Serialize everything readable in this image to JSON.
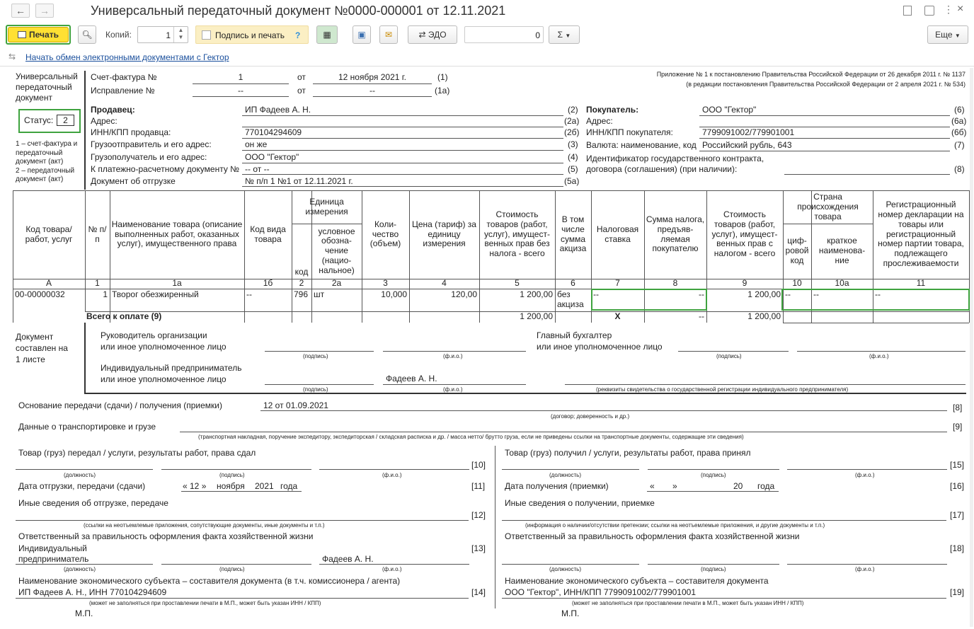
{
  "window": {
    "title": "Универсальный передаточный документ №0000-000001 от 12.11.2021",
    "back_icon": "arrow-left-icon",
    "forward_icon": "arrow-right-icon"
  },
  "toolbar": {
    "print_label": "Печать",
    "copies_label": "Копий:",
    "copies_value": "1",
    "sign_print_label": "Подпись и печать",
    "help_mark": "?",
    "edo_label": "ЭДО",
    "sum_value": "0",
    "sigma_label": "Σ",
    "more_label": "Еще"
  },
  "link_exchange": "Начать обмен электронными документами с Гектор",
  "left_panel": {
    "doc_type": [
      "Универсальный",
      "передаточный",
      "документ"
    ],
    "status_label": "Статус:",
    "status_value": "2",
    "status_note1": [
      "1 – счет-фактура и",
      "передаточный",
      "документ (акт)"
    ],
    "status_note2": [
      "2 – передаточный",
      "документ (акт)"
    ],
    "compiled_on": [
      "Документ",
      "составлен на",
      "1 листе"
    ]
  },
  "invoice": {
    "sf_label": "Счет-фактура №",
    "sf_no": "1",
    "from_label": "от",
    "sf_date": "12 ноября 2021 г.",
    "sf_ref": "(1)",
    "corr_label": "Исправление №",
    "corr_no": "--",
    "corr_date": "--",
    "corr_ref": "(1а)",
    "appendix1": "Приложение № 1 к постановлению Правительства Российской Федерации от 26 декабря 2011 г. № 1137",
    "appendix2": "(в редакции постановления Правительства Российской Федерации от 2 апреля 2021 г. № 534)"
  },
  "seller": {
    "label": "Продавец:",
    "value": "ИП Фадеев А. Н.",
    "ref": "(2)",
    "addr_label": "Адрес:",
    "addr_ref": "(2а)",
    "inn_label": "ИНН/КПП продавца:",
    "inn_value": "770104294609",
    "inn_ref": "(2б)",
    "shipper_label": "Грузоотправитель и его адрес:",
    "shipper_value": "он же",
    "shipper_ref": "(3)",
    "consignee_label": "Грузополучатель и его адрес:",
    "consignee_value": "ООО \"Гектор\"",
    "consignee_ref": "(4)",
    "paydoc_label": "К платежно-расчетному документу №",
    "paydoc_value": "-- от --",
    "paydoc_ref": "(5)",
    "shipdoc_label": "Документ об отгрузке",
    "shipdoc_value": "№ п/п 1 №1 от 12.11.2021 г.",
    "shipdoc_ref": "(5а)"
  },
  "buyer": {
    "label": "Покупатель:",
    "value": "ООО \"Гектор\"",
    "ref": "(6)",
    "addr_label": "Адрес:",
    "addr_ref": "(6а)",
    "inn_label": "ИНН/КПП покупателя:",
    "inn_value": "7799091002/779901001",
    "inn_ref": "(6б)",
    "currency_label": "Валюта: наименование, код",
    "currency_value": "Российский рубль, 643",
    "currency_ref": "(7)",
    "contract_label1": "Идентификатор государственного контракта,",
    "contract_label2": "договора (соглашения) (при наличии):",
    "contract_ref": "(8)"
  },
  "table": {
    "headers": {
      "code": "Код товара/ работ, услуг",
      "n": "№ п/п",
      "name": "Наименование товара (описание выполненных работ, оказанных услуг), имущественного права",
      "kind": "Код вида товара",
      "unit": "Единица измерения",
      "unit_code": "код",
      "unit_name": "условное обозна-чение (нацио-нальное)",
      "qty": "Коли-чество (объем)",
      "price": "Цена (тариф) за единицу измерения",
      "cost": "Стоимость товаров (работ, услуг), имущест-венных прав без налога - всего",
      "excise": "В том числе сумма акциза",
      "rate": "Налоговая ставка",
      "tax": "Сумма налога, предъяв-ляемая покупателю",
      "total": "Стоимость товаров (работ, услуг), имущест-венных прав с налогом - всего",
      "country": "Страна происхождения товара",
      "country_code": "циф-ровой код",
      "country_name": "краткое наименова-ние",
      "reg": "Регистрационный номер декларации на товары или регистрационный номер партии товара, подлежащего прослеживаемости"
    },
    "col_numbers": [
      "А",
      "1",
      "1а",
      "1б",
      "2",
      "2а",
      "3",
      "4",
      "5",
      "6",
      "7",
      "8",
      "9",
      "10",
      "10а",
      "11"
    ],
    "rows": [
      {
        "code": "00-00000032",
        "n": "1",
        "name": "Творог обезжиренный",
        "kind": "--",
        "unit_code": "796",
        "unit_name": "шт",
        "qty": "10,000",
        "price": "120,00",
        "cost": "1 200,00",
        "excise": "без акциза",
        "rate": "--",
        "tax": "--",
        "total": "1 200,00",
        "country_code": "--",
        "country_name": "--",
        "reg": "--"
      }
    ],
    "total_label": "Всего к оплате (9)",
    "total_cost": "1 200,00",
    "total_x": "Х",
    "total_tax": "--",
    "total_sum": "1 200,00"
  },
  "signatures": {
    "head_label1": "Руководитель организации",
    "head_label2": "или иное уполномоченное лицо",
    "chief_label1": "Главный бухгалтер",
    "chief_label2": "или иное уполномоченное лицо",
    "ip_label1": "Индивидуальный предприниматель",
    "ip_label2": "или иное уполномоченное лицо",
    "ip_name": "Фадеев А. Н.",
    "sign_hint": "(подпись)",
    "fio_hint": "(ф.и.о.)",
    "reg_hint": "(реквизиты свидетельства о государственной  регистрации индивидуального предпринимателя)"
  },
  "transfer": {
    "basis_label": "Основание передачи (сдачи) / получения (приемки)",
    "basis_value": "12 от 01.09.2021",
    "basis_hint": "(договор; доверенность и др.)",
    "basis_ref": "[8]",
    "transport_label": "Данные о транспортировке и грузе",
    "transport_hint": "(транспортная накладная, поручение экспедитору, экспедиторская / складская расписка и др. / масса нетто/ брутто груза, если не приведены ссылки на транспортные документы, содержащие эти сведения)",
    "transport_ref": "[9]"
  },
  "left_block": {
    "handed_label": "Товар (груз) передал / услуги, результаты работ, права сдал",
    "ref10": "[10]",
    "pos_hint": "(должность)",
    "sign_hint": "(подпись)",
    "fio_hint": "(ф.и.о.)",
    "ship_date_label": "Дата отгрузки, передачи (сдачи)",
    "ship_day": "« 12 »",
    "ship_month": "ноября",
    "ship_year": "2021",
    "year_word": "года",
    "ref11": "[11]",
    "other_label": "Иные сведения об отгрузке, передаче",
    "ref12": "[12]",
    "other_hint": "(ссылки на неотъемлемые приложения, сопутствующие документы, иные документы и т.п.)",
    "resp_label": "Ответственный за правильность оформления факта хозяйственной жизни",
    "resp_pos1": "Индивидуальный",
    "resp_pos2": "предприниматель",
    "resp_name": "Фадеев А. Н.",
    "ref13": "[13]",
    "entity_label": "Наименование экономического субъекта – составителя документа (в т.ч. комиссионера / агента)",
    "entity_value": "ИП Фадеев А. Н., ИНН 770104294609",
    "ref14": "[14]",
    "entity_hint": "(может не заполняться при проставлении печати в М.П., может быть указан ИНН / КПП)",
    "mp": "М.П."
  },
  "right_block": {
    "received_label": "Товар (груз) получил / услуги, результаты работ, права принял",
    "ref15": "[15]",
    "pos_hint": "(должность)",
    "sign_hint": "(подпись)",
    "fio_hint": "(ф.и.о.)",
    "recv_date_label": "Дата получения (приемки)",
    "recv_day_open": "«",
    "recv_day_close": "»",
    "recv_year": "20",
    "year_word": "года",
    "ref16": "[16]",
    "other_label": "Иные сведения о получении, приемке",
    "ref17": "[17]",
    "other_hint": "(информация о наличии/отсутствии претензии; ссылки на неотъемлемые приложения, и другие  документы и т.п.)",
    "resp_label": "Ответственный за правильность оформления факта хозяйственной жизни",
    "ref18": "[18]",
    "entity_label": "Наименование экономического субъекта – составителя документа",
    "entity_value": "ООО \"Гектор\", ИНН/КПП 7799091002/779901001",
    "ref19": "[19]",
    "entity_hint": "(может не заполняться при проставлении печати в М.П., может быть указан ИНН / КПП)",
    "mp": "М.П."
  },
  "colors": {
    "print_button": "#ffe033",
    "highlight": "#3fa33f",
    "link": "#1a4f9c"
  }
}
